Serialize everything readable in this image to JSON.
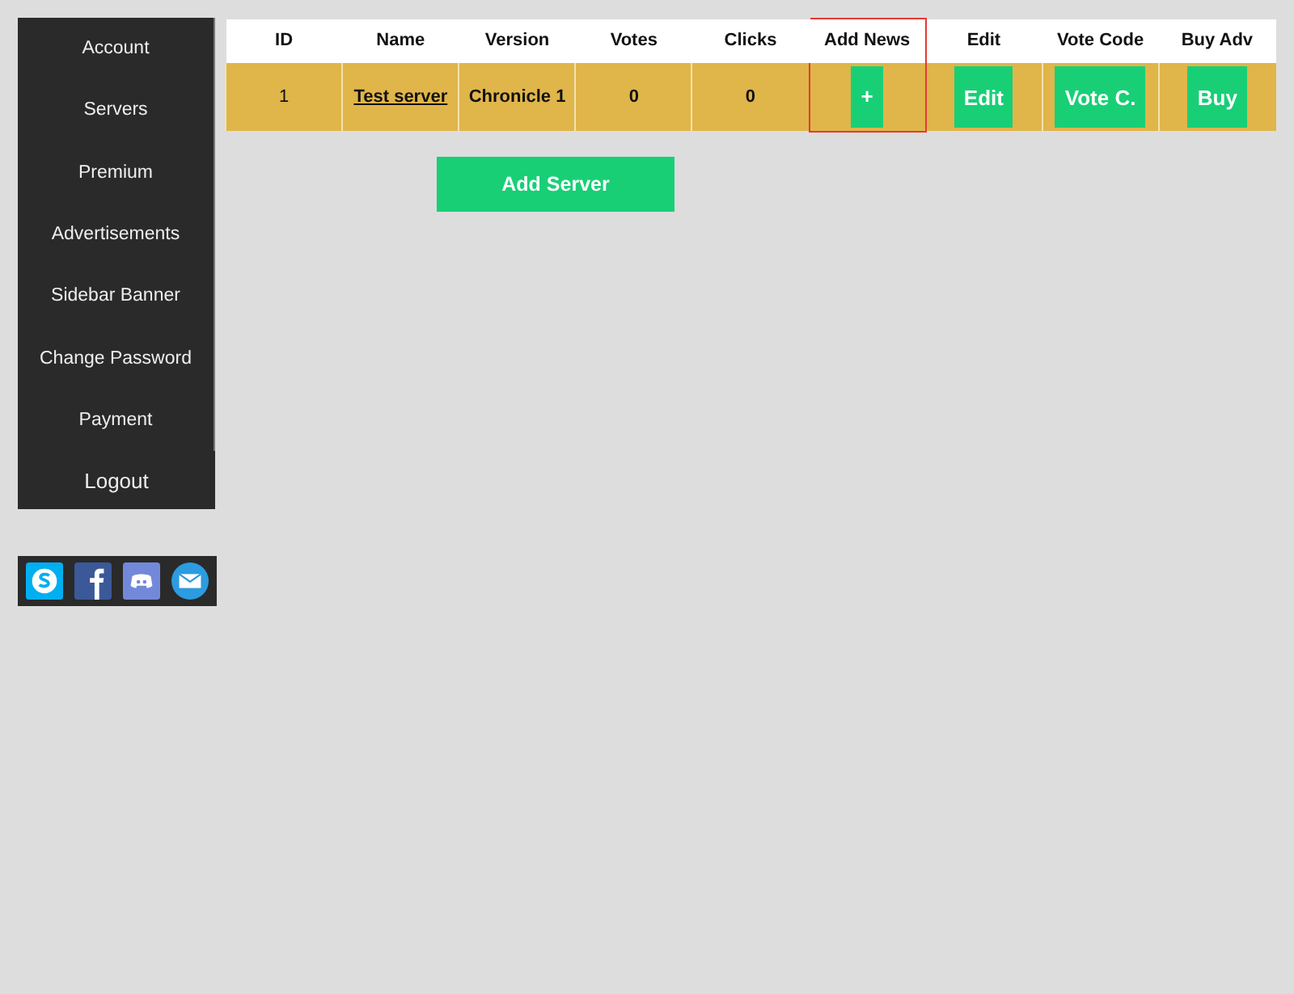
{
  "sidebar": {
    "items": [
      "Account",
      "Servers",
      "Premium",
      "Advertisements",
      "Sidebar Banner",
      "Change Password",
      "Payment"
    ],
    "logout": "Logout"
  },
  "social": [
    {
      "kind": "skype"
    },
    {
      "kind": "facebook"
    },
    {
      "kind": "discord"
    },
    {
      "kind": "mail"
    }
  ],
  "table": {
    "columns": [
      {
        "label": "ID",
        "selected": false
      },
      {
        "label": "Name",
        "selected": false
      },
      {
        "label": "Version",
        "selected": false
      },
      {
        "label": "Votes",
        "selected": false
      },
      {
        "label": "Clicks",
        "selected": false
      },
      {
        "label": "Add News",
        "selected": true
      },
      {
        "label": "Edit",
        "selected": false
      },
      {
        "label": "Vote Code",
        "selected": false
      },
      {
        "label": "Buy Adv",
        "selected": false
      }
    ],
    "rows": [
      [
        {
          "kind": "text",
          "text": "1"
        },
        {
          "kind": "link",
          "text": "Test server"
        },
        {
          "kind": "bold",
          "text": "Chronicle 1"
        },
        {
          "kind": "bold",
          "text": "0"
        },
        {
          "kind": "bold",
          "text": "0"
        },
        {
          "kind": "button",
          "text": "+"
        },
        {
          "kind": "button",
          "text": "Edit"
        },
        {
          "kind": "button",
          "text": "Vote C."
        },
        {
          "kind": "button",
          "text": "Buy"
        }
      ]
    ]
  },
  "add_server": "Add Server"
}
